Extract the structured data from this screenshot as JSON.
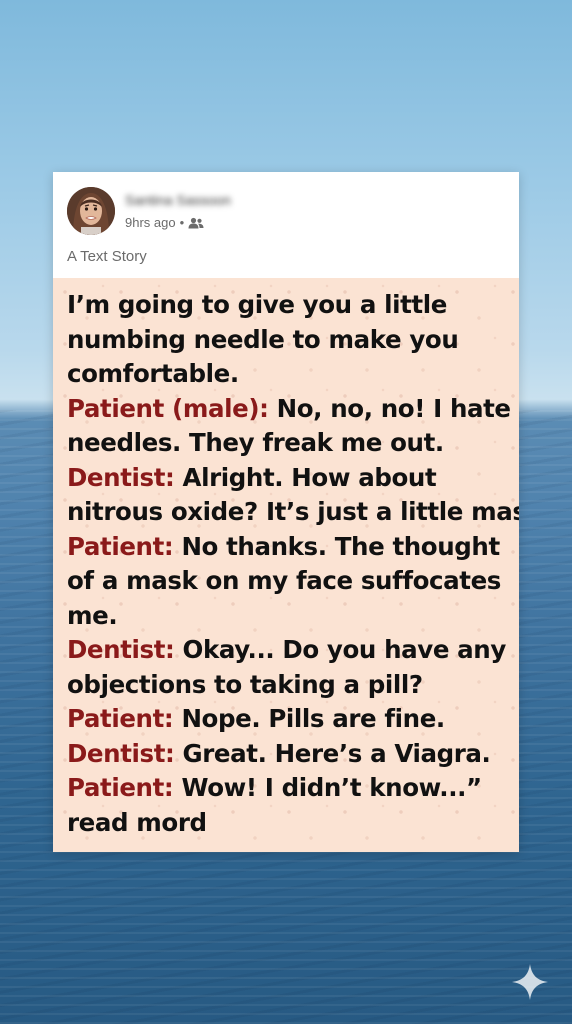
{
  "post": {
    "author_name": "Santina Sassoon",
    "time": "9hrs ago",
    "separator": "•",
    "audience_icon": "friends-icon",
    "subtitle": "A Text Story"
  },
  "story": {
    "lines": [
      {
        "speaker": "",
        "text": "I’m going to give you a little"
      },
      {
        "speaker": "",
        "text": "numbing needle to make you"
      },
      {
        "speaker": "",
        "text": "comfortable."
      },
      {
        "speaker": "Patient (male):",
        "text": " No, no, no! I hate"
      },
      {
        "speaker": "",
        "text": "needles. They freak me out."
      },
      {
        "speaker": "Dentist:",
        "text": " Alright. How about"
      },
      {
        "speaker": "",
        "text": "nitrous oxide? It’s just a little mask"
      },
      {
        "speaker": "Patient:",
        "text": " No thanks. The thought"
      },
      {
        "speaker": "",
        "text": "of a mask on my face suffocates"
      },
      {
        "speaker": "",
        "text": "me."
      },
      {
        "speaker": "Dentist:",
        "text": " Okay... Do you have any"
      },
      {
        "speaker": "",
        "text": "objections to taking a pill?"
      },
      {
        "speaker": "Patient:",
        "text": " Nope. Pills are fine."
      },
      {
        "speaker": "Dentist:",
        "text": " Great. Here’s a Viagra."
      },
      {
        "speaker": "Patient:",
        "text": " Wow! I didn’t know...”"
      },
      {
        "speaker": "",
        "text": "read mord"
      }
    ]
  },
  "colors": {
    "speaker": "#8a1a1a",
    "story_bg": "#fbe3d3",
    "text": "#111111"
  },
  "overlay": {
    "sparkle_icon": "sparkle-icon"
  }
}
